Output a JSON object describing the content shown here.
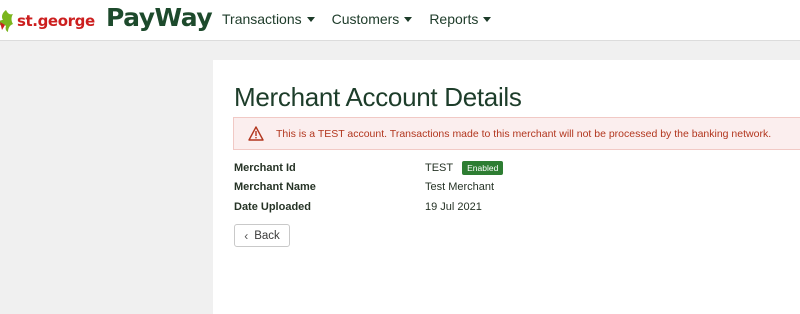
{
  "header": {
    "logo_text": "st.george",
    "brand": "PayWay",
    "nav": [
      {
        "label": "Transactions"
      },
      {
        "label": "Customers"
      },
      {
        "label": "Reports"
      }
    ]
  },
  "main": {
    "title": "Merchant Account Details",
    "alert": "This is a TEST account. Transactions made to this merchant will not be processed by the banking network.",
    "details": {
      "merchant_id": {
        "label": "Merchant Id",
        "value": "TEST",
        "badge": "Enabled"
      },
      "merchant_name": {
        "label": "Merchant Name",
        "value": "Test Merchant"
      },
      "date_uploaded": {
        "label": "Date Uploaded",
        "value": "19 Jul 2021"
      }
    },
    "back_label": "Back"
  },
  "colors": {
    "brand_green": "#1d4a2c",
    "logo_red": "#cc1f1f",
    "alert_text": "#b2361e",
    "alert_bg": "#fbeeee",
    "badge_green": "#2d7d32"
  }
}
